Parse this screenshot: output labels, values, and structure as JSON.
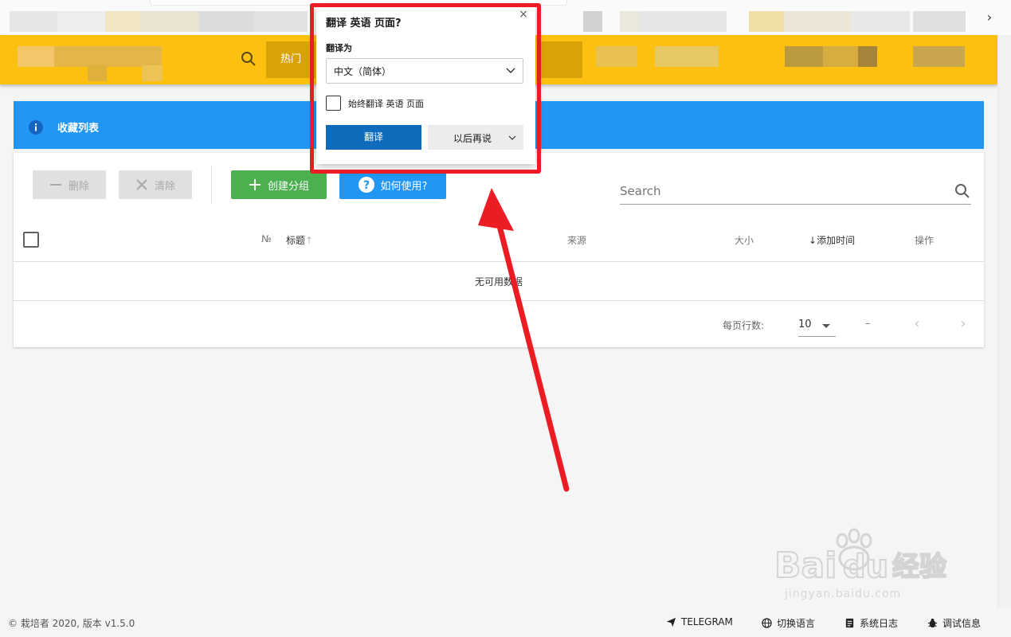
{
  "appbar": {
    "hot_label": "热门"
  },
  "banner": {
    "title": "收藏列表"
  },
  "toolbar": {
    "delete_label": "删除",
    "clear_label": "清除",
    "create_group_label": "创建分组",
    "how_to_use_label": "如何使用?"
  },
  "search": {
    "placeholder": "Search"
  },
  "table": {
    "columns": {
      "number": "№",
      "title": "标题",
      "source": "来源",
      "size": "大小",
      "added_time": "添加时间",
      "actions": "操作"
    },
    "empty_text": "无可用数据"
  },
  "pagination": {
    "rows_per_page_label": "每页行数:",
    "rows_per_page_value": "10",
    "range_text": "–"
  },
  "translate_popup": {
    "title": "翻译 英语 页面?",
    "translate_to_label": "翻译为",
    "selected_language": "中文（简体）",
    "always_translate_label": "始终翻译 英语 页面",
    "translate_button": "翻译",
    "not_now_button": "以后再说"
  },
  "footer": {
    "copyright": "© 栽培者 2020, 版本 v1.5.0",
    "telegram": "TELEGRAM",
    "switch_language": "切换语言",
    "system_log": "系统日志",
    "debug_info": "调试信息"
  },
  "watermark": {
    "url": "jingyan.baidu.com",
    "logo_text": "Baidu经验"
  },
  "colors": {
    "appbar": "#fcc010",
    "banner": "#2196f3",
    "create_button": "#4caf50",
    "help_button": "#2196f3",
    "translate_button": "#0f6cbd",
    "annotation": "#ec1c24"
  },
  "icons": {
    "appbar_search": "search-icon",
    "banner": "info-icon",
    "delete": "minus-icon",
    "clear": "close-icon",
    "create": "plus-icon",
    "help": "help-circle-icon",
    "search": "search-icon",
    "sort_title": "arrow-up-icon",
    "sort_time": "arrow-down-icon",
    "telegram": "send-icon",
    "language": "globe-icon",
    "log": "document-icon",
    "debug": "bug-icon"
  }
}
